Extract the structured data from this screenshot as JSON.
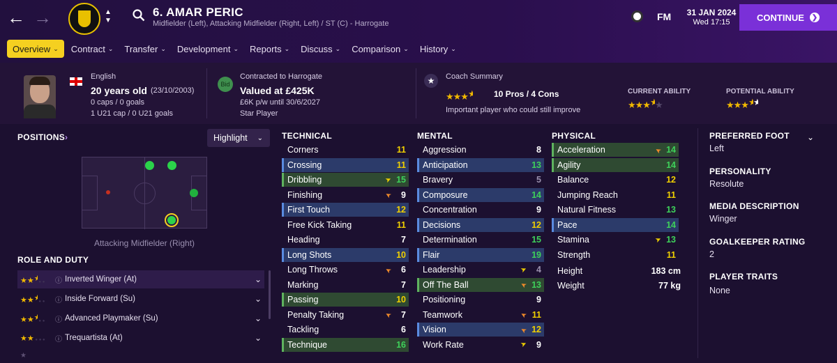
{
  "header": {
    "player_title": "6. AMAR PERIC",
    "subtitle": "Midfielder (Left), Attacking Midfielder (Right, Left) / ST (C) - Harrogate",
    "date": "31 JAN 2024",
    "time": "Wed 17:15",
    "fm_label": "FM",
    "continue_label": "CONTINUE"
  },
  "tabs": [
    "Overview",
    "Contract",
    "Transfer",
    "Development",
    "Reports",
    "Discuss",
    "Comparison",
    "History"
  ],
  "info": {
    "nationality": "English",
    "age": "20 years old",
    "dob": "(23/10/2003)",
    "caps": "0 caps / 0 goals",
    "u21": "1 U21 cap / 0 U21 goals",
    "contract_label": "Contracted to Harrogate",
    "bid": "Bid",
    "value": "Valued at £425K",
    "wage": "£6K p/w until 30/6/2027",
    "status": "Star Player",
    "coach_label": "Coach Summary",
    "pros_cons": "10 Pros / 4 Cons",
    "coach_note": "Important player who could still improve",
    "current_ability_label": "CURRENT ABILITY",
    "potential_ability_label": "POTENTIAL ABILITY",
    "current_ability_stars": 3.5,
    "potential_ability_stars": 3.5,
    "coach_stars": 3.5
  },
  "positions": {
    "title": "POSITIONS",
    "highlight": "Highlight",
    "position_label": "Attacking Midfielder (Right)"
  },
  "roles": {
    "title": "ROLE AND DUTY",
    "items": [
      {
        "name": "Inverted Winger (At)",
        "stars": 2.5
      },
      {
        "name": "Inside Forward (Su)",
        "stars": 2.5
      },
      {
        "name": "Advanced Playmaker (Su)",
        "stars": 2.5
      },
      {
        "name": "Trequartista (At)",
        "stars": 2
      }
    ]
  },
  "technical": {
    "title": "TECHNICAL",
    "items": [
      {
        "name": "Corners",
        "value": "11",
        "style": "",
        "arrow": ""
      },
      {
        "name": "Crossing",
        "value": "11",
        "style": "hl",
        "arrow": ""
      },
      {
        "name": "Dribbling",
        "value": "15",
        "style": "gr",
        "arrow": "up"
      },
      {
        "name": "Finishing",
        "value": "9",
        "style": "",
        "arrow": "down"
      },
      {
        "name": "First Touch",
        "value": "12",
        "style": "hl",
        "arrow": ""
      },
      {
        "name": "Free Kick Taking",
        "value": "11",
        "style": "",
        "arrow": ""
      },
      {
        "name": "Heading",
        "value": "7",
        "style": "",
        "arrow": ""
      },
      {
        "name": "Long Shots",
        "value": "10",
        "style": "hl",
        "arrow": ""
      },
      {
        "name": "Long Throws",
        "value": "6",
        "style": "",
        "arrow": "down"
      },
      {
        "name": "Marking",
        "value": "7",
        "style": "",
        "arrow": ""
      },
      {
        "name": "Passing",
        "value": "10",
        "style": "gr",
        "arrow": ""
      },
      {
        "name": "Penalty Taking",
        "value": "7",
        "style": "",
        "arrow": "down"
      },
      {
        "name": "Tackling",
        "value": "6",
        "style": "",
        "arrow": ""
      },
      {
        "name": "Technique",
        "value": "16",
        "style": "gr",
        "arrow": ""
      }
    ]
  },
  "mental": {
    "title": "MENTAL",
    "items": [
      {
        "name": "Aggression",
        "value": "8",
        "style": "",
        "arrow": ""
      },
      {
        "name": "Anticipation",
        "value": "13",
        "style": "hl",
        "arrow": ""
      },
      {
        "name": "Bravery",
        "value": "5",
        "style": "",
        "arrow": ""
      },
      {
        "name": "Composure",
        "value": "14",
        "style": "hl",
        "arrow": ""
      },
      {
        "name": "Concentration",
        "value": "9",
        "style": "",
        "arrow": ""
      },
      {
        "name": "Decisions",
        "value": "12",
        "style": "hl",
        "arrow": ""
      },
      {
        "name": "Determination",
        "value": "15",
        "style": "",
        "arrow": ""
      },
      {
        "name": "Flair",
        "value": "19",
        "style": "hl",
        "arrow": ""
      },
      {
        "name": "Leadership",
        "value": "4",
        "style": "",
        "arrow": "up"
      },
      {
        "name": "Off The Ball",
        "value": "13",
        "style": "gr",
        "arrow": "down"
      },
      {
        "name": "Positioning",
        "value": "9",
        "style": "",
        "arrow": ""
      },
      {
        "name": "Teamwork",
        "value": "11",
        "style": "",
        "arrow": "down"
      },
      {
        "name": "Vision",
        "value": "12",
        "style": "hl",
        "arrow": "down"
      },
      {
        "name": "Work Rate",
        "value": "9",
        "style": "",
        "arrow": "up"
      }
    ]
  },
  "physical": {
    "title": "PHYSICAL",
    "items": [
      {
        "name": "Acceleration",
        "value": "14",
        "style": "gr",
        "arrow": "down"
      },
      {
        "name": "Agility",
        "value": "14",
        "style": "gr",
        "arrow": ""
      },
      {
        "name": "Balance",
        "value": "12",
        "style": "",
        "arrow": ""
      },
      {
        "name": "Jumping Reach",
        "value": "11",
        "style": "",
        "arrow": ""
      },
      {
        "name": "Natural Fitness",
        "value": "13",
        "style": "",
        "arrow": ""
      },
      {
        "name": "Pace",
        "value": "14",
        "style": "hl",
        "arrow": ""
      },
      {
        "name": "Stamina",
        "value": "13",
        "style": "",
        "arrow": "up"
      },
      {
        "name": "Strength",
        "value": "11",
        "style": "",
        "arrow": ""
      }
    ],
    "height_label": "Height",
    "height": "183 cm",
    "weight_label": "Weight",
    "weight": "77 kg"
  },
  "side": {
    "foot_label": "PREFERRED FOOT",
    "foot": "Left",
    "personality_label": "PERSONALITY",
    "personality": "Resolute",
    "media_label": "MEDIA DESCRIPTION",
    "media": "Winger",
    "gk_label": "GOALKEEPER RATING",
    "gk": "2",
    "traits_label": "PLAYER TRAITS",
    "traits": "None"
  },
  "colors": {
    "accent": "#f5d020",
    "continue": "#7a30d8",
    "highlight_blue": "#2c3b6a",
    "highlight_green": "#2f4a32",
    "value_yellow": "#f0d000",
    "value_green": "#3ed15a"
  }
}
